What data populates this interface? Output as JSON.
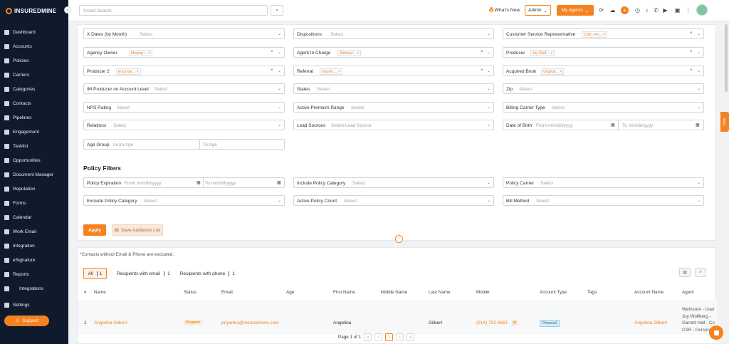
{
  "app": {
    "logo": "INSUREDMINE",
    "brand_color": "#f58220",
    "sidebar_bg": "#0f1b2d"
  },
  "sidebar": {
    "items": [
      {
        "label": "Dashboard",
        "icon": "dashboard-icon"
      },
      {
        "label": "Accounts",
        "icon": "accounts-icon"
      },
      {
        "label": "Policies",
        "icon": "policies-icon"
      },
      {
        "label": "Carriers",
        "icon": "carriers-icon"
      },
      {
        "label": "Categories",
        "icon": "categories-icon"
      },
      {
        "label": "Contacts",
        "icon": "contacts-icon"
      },
      {
        "label": "Pipelines",
        "icon": "pipelines-icon"
      },
      {
        "label": "Engagement",
        "icon": "engagement-icon"
      },
      {
        "label": "Tasklist",
        "icon": "tasklist-icon"
      },
      {
        "label": "Opportunities",
        "icon": "opportunities-icon"
      },
      {
        "label": "Document Manager",
        "icon": "document-manager-icon"
      },
      {
        "label": "Reputation",
        "icon": "reputation-icon"
      },
      {
        "label": "Forms",
        "icon": "forms-icon"
      },
      {
        "label": "Calendar",
        "icon": "calendar-icon"
      },
      {
        "label": "Work Email",
        "icon": "work-email-icon"
      },
      {
        "label": "Integration",
        "icon": "integration-icon"
      },
      {
        "label": "eSignature",
        "icon": "esignature-icon"
      },
      {
        "label": "Reports",
        "icon": "reports-icon"
      },
      {
        "label": "Integrations",
        "icon": "integrations-icon"
      },
      {
        "label": "Settings",
        "icon": "settings-icon"
      }
    ],
    "support_label": "Support"
  },
  "topbar": {
    "search_placeholder": "Smart Search",
    "whats_new": "What's New",
    "admin_label": "Admin",
    "my_agents_label": "My Agents"
  },
  "filters": {
    "x_dates": {
      "label": "X Dates (by Month)",
      "value": "Select"
    },
    "dispositions": {
      "label": "Dispositions",
      "value": "Select"
    },
    "csr": {
      "label": "Customer Service Representative",
      "tag": "CSR - Pe..."
    },
    "agency_owner": {
      "label": "Agency Owner",
      "tag": "Missing ..."
    },
    "agent_in_charge": {
      "label": "Agent In Charge",
      "tag": "WeInsur..."
    },
    "producer": {
      "label": "Producer",
      "tag": "Joy Wolf..."
    },
    "producer2": {
      "label": "Producer 2",
      "tag": "Erica Ge..."
    },
    "referral": {
      "label": "Referral",
      "tag": "Garrett ..."
    },
    "acquired_book": {
      "label": "Acquired Book",
      "tag": "Original..."
    },
    "im_producer": {
      "label": "IM Producer on Account Level",
      "value": "Select"
    },
    "states": {
      "label": "States",
      "value": "Select"
    },
    "zip": {
      "label": "Zip",
      "value": "Select"
    },
    "nps": {
      "label": "NPS Rating",
      "value": "Select"
    },
    "active_premium": {
      "label": "Active Premium Range",
      "value": "Select"
    },
    "billing_carrier": {
      "label": "Billing Carrier Type",
      "value": "Select"
    },
    "relations": {
      "label": "Relations",
      "value": "Select"
    },
    "lead_sources": {
      "label": "Lead Sources",
      "value": "Select Lead Source"
    },
    "dob": {
      "label": "Date of Birth",
      "from": "From mm/dd/yyyy",
      "to": "To mm/dd/yyyy"
    },
    "age_group": {
      "label": "Age Group",
      "from": "From Age",
      "to": "To Age"
    }
  },
  "policy_filters": {
    "title": "Policy Filters",
    "expiration": {
      "label": "Policy Expiration",
      "from": "From mm/dd/yyyy",
      "to": "To mm/dd/yyyy"
    },
    "include_category": {
      "label": "Include Policy Category",
      "value": "Select"
    },
    "carrier": {
      "label": "Policy Carrier",
      "value": "Select"
    },
    "exclude_category": {
      "label": "Exclude Policy Category",
      "value": "Select"
    },
    "active_count": {
      "label": "Active Policy Count",
      "value": "Select"
    },
    "bill_method": {
      "label": "Bill Method",
      "value": "Select"
    }
  },
  "actions": {
    "apply": "Apply",
    "save": "Save Audience List"
  },
  "results": {
    "note": "*Contacts without Email & Phone are excluded.",
    "tabs": [
      {
        "label": "All",
        "count": "1"
      },
      {
        "label": "Recipients with email",
        "count": "1"
      },
      {
        "label": "Recipients with phone",
        "count": "1"
      }
    ],
    "columns": [
      "#",
      "Name",
      "Status",
      "Email",
      "Age",
      "First Name",
      "Middle Name",
      "Last Name",
      "Mobile",
      "Account Type",
      "Tags",
      "Account Name",
      "Agent"
    ],
    "rows": [
      {
        "num": "1",
        "name": "Angelina Gilbert",
        "status": "Prospect",
        "email": "priyanka@insuredmine.com",
        "age": "",
        "first": "Angelina",
        "middle": "",
        "last": "Gilbert",
        "mobile": "(214) 702-9691",
        "account_type": "Personal",
        "tags": "",
        "account_name": "Angelina Gilbert",
        "agent_lines": [
          "WeInsure - User",
          "Joy Wolfberg - ",
          "Garrett Hall - Co",
          "CSR - Person"
        ]
      }
    ],
    "pager": {
      "text": "Page 1 of 1",
      "current": "1"
    }
  },
  "help_label": "Help"
}
